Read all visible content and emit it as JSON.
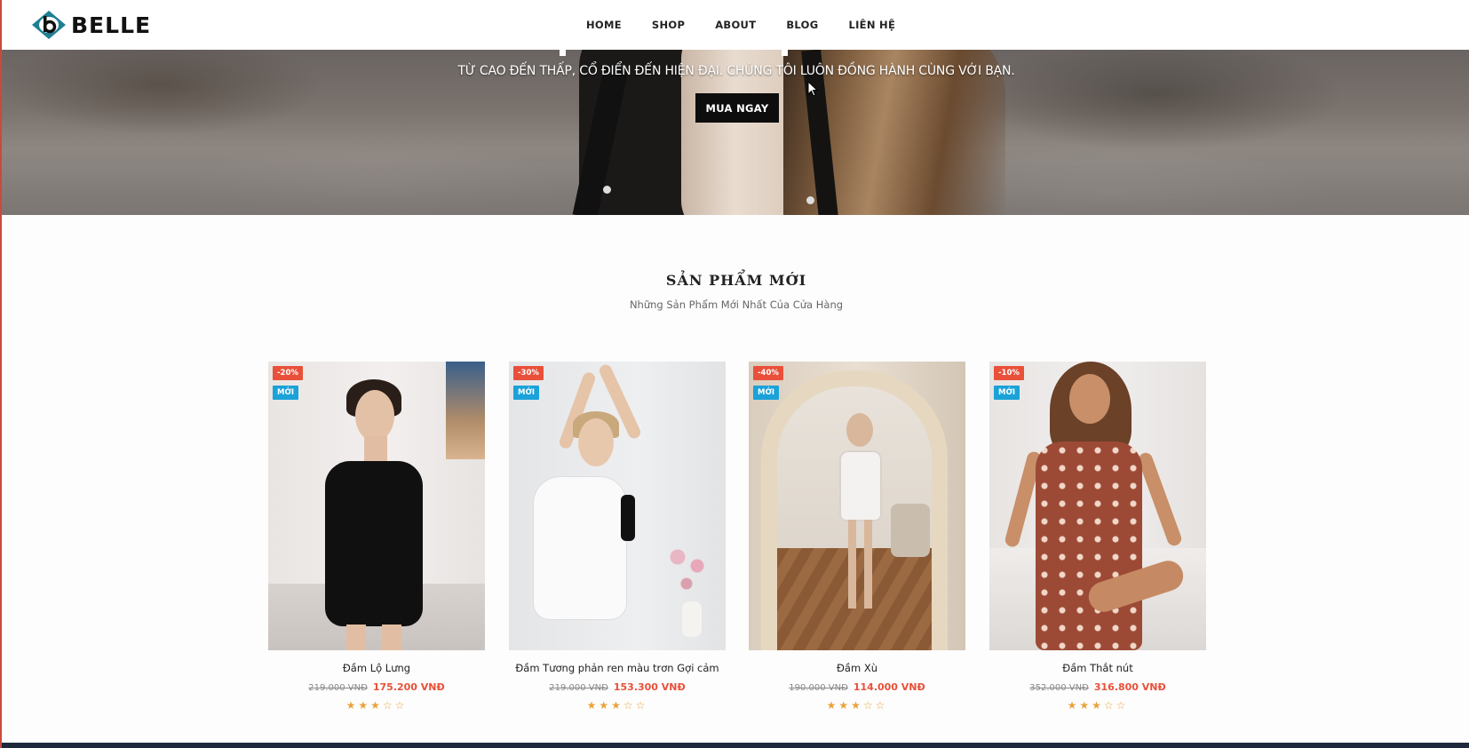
{
  "brand": {
    "name": "BELLE",
    "logo_icon": "b-eye-logo",
    "accent": "#1f7f93"
  },
  "nav": [
    {
      "label": "HOME"
    },
    {
      "label": "SHOP"
    },
    {
      "label": "ABOUT"
    },
    {
      "label": "BLOG"
    },
    {
      "label": "LIÊN HỆ"
    }
  ],
  "hero": {
    "tagline": "TỪ CAO ĐẾN THẤP, CỔ ĐIỂN ĐẾN HIỆN ĐẠI. CHÚNG TÔI LUÔN ĐỒNG HÀNH CÙNG VỚI BẠN.",
    "cta": "MUA NGAY"
  },
  "section": {
    "title": "SẢN PHẨM MỚI",
    "subtitle": "Những Sản Phẩm Mới Nhất Của Cửa Hàng"
  },
  "products": [
    {
      "name": "Đầm Lộ Lưng",
      "discount": "-20%",
      "badge": "MỚI",
      "old_price": "219.000 VNĐ",
      "price": "175.200 VNĐ",
      "rating": 3,
      "max_rating": 5
    },
    {
      "name": "Đầm Tương phản ren màu trơn Gợi cảm",
      "discount": "-30%",
      "badge": "MỚI",
      "old_price": "219.000 VNĐ",
      "price": "153.300 VNĐ",
      "rating": 3,
      "max_rating": 5
    },
    {
      "name": "Đầm Xù",
      "discount": "-40%",
      "badge": "MỚI",
      "old_price": "190.000 VNĐ",
      "price": "114.000 VNĐ",
      "rating": 3,
      "max_rating": 5
    },
    {
      "name": "Đầm Thắt nút",
      "discount": "-10%",
      "badge": "MỚI",
      "old_price": "352.000 VNĐ",
      "price": "316.800 VNĐ",
      "rating": 3,
      "max_rating": 5
    }
  ],
  "colors": {
    "sale_badge": "#e9503a",
    "new_badge": "#1ba2d8",
    "price": "#e9503a",
    "star": "#e8a33b",
    "cta_bg": "#0d0d0d"
  }
}
